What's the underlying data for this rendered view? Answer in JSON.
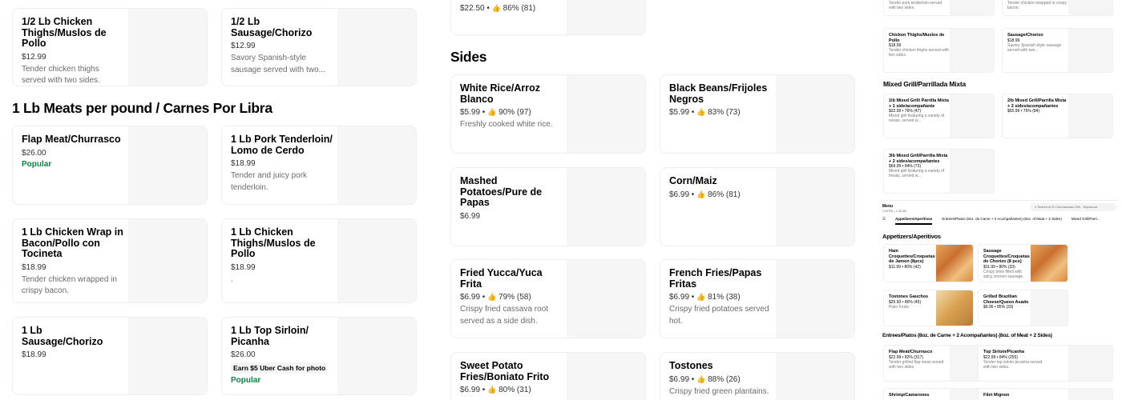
{
  "left": {
    "top_items": [
      {
        "name": "1/2 Lb Chicken Thighs/Muslos de Pollo",
        "price": "$12.99",
        "desc": "Tender chicken thighs served with two sides."
      },
      {
        "name": "1/2 Lb Sausage/Chorizo",
        "price": "$12.99",
        "desc": "Savory Spanish-style sausage served with two..."
      }
    ],
    "section_title": "1 Lb Meats per pound / Carnes Por Libra",
    "items": [
      {
        "name": "Flap Meat/Churrasco",
        "price": "$26.00",
        "popular": "Popular"
      },
      {
        "name": "1 Lb Pork Tenderloin/ Lomo de Cerdo",
        "price": "$18.99",
        "desc": "Tender and juicy pork tenderloin."
      },
      {
        "name": "1 Lb Chicken Wrap in Bacon/Pollo con Tocineta",
        "price": "$18.99",
        "desc": "Tender chicken wrapped in crispy bacon."
      },
      {
        "name": "1 Lb Chicken Thighs/Muslos de Pollo",
        "price": "$18.99",
        "desc": "."
      },
      {
        "name": "1 Lb Sausage/Chorizo",
        "price": "$18.99"
      },
      {
        "name": "1 Lb Top Sirloin/ Picanha",
        "price": "$26.00",
        "promo": "Earn $5 Uber Cash for photo",
        "popular": "Popular"
      }
    ]
  },
  "middle": {
    "top_item": {
      "price": "$22.50",
      "rating": "86% (81)"
    },
    "section_title": "Sides",
    "items": [
      {
        "name": "White Rice/Arroz Blanco",
        "price": "$5.99",
        "rating": "90% (97)",
        "desc": "Freshly cooked white rice."
      },
      {
        "name": "Black Beans/Frijoles Negros",
        "price": "$5.99",
        "rating": "83% (73)"
      },
      {
        "name": "Mashed Potatoes/Pure de Papas",
        "price": "$6.99"
      },
      {
        "name": "Corn/Maiz",
        "price": "$6.99",
        "rating": "86% (81)"
      },
      {
        "name": "Fried Yucca/Yuca Frita",
        "price": "$6.99",
        "rating": "79% (58)",
        "desc": "Crispy fried cassava root served as a side dish."
      },
      {
        "name": "French Fries/Papas Fritas",
        "price": "$6.99",
        "rating": "81% (38)",
        "desc": "Crispy fried potatoes served hot."
      },
      {
        "name": "Sweet Potato Fries/Boniato Frito",
        "price": "$6.99",
        "rating": "80% (31)"
      },
      {
        "name": "Tostones",
        "price": "$6.99",
        "rating": "88% (26)",
        "desc": "Crispy fried green plantains."
      }
    ]
  },
  "preview": {
    "top_row": [
      {
        "desc": "Tender pork tenderloin served with two sides."
      },
      {
        "desc": "Tender chicken wrapped in crispy bacon."
      }
    ],
    "row2": [
      {
        "name": "Chicken Thighs/Muslos de Pollo",
        "price": "$18.99",
        "desc": "Tender chicken thighs served with two sides."
      },
      {
        "name": "Sausage/Chorizo",
        "price": "$18.99",
        "desc": "Savory Spanish-style sausage served with two..."
      }
    ],
    "mixed_title": "Mixed Grill/Parrillada Mixta",
    "mixed": [
      {
        "name": "1lb Mixed Grill/ Parrilla Mixta + 1 side/acompañante",
        "price": "$32.99 • 76% (47)",
        "desc": "Mixed grill featuring a variety of meats, served w..."
      },
      {
        "name": "2lb Mixed Grill/Parrilla Mixta + 2 sides/acompañantes",
        "price": "$55.99 • 75% (84)"
      },
      {
        "name": "3lb Mixed Grill/Parrilla Mixta + 2 sides/acompañantes",
        "price": "$69.99 • 84% (73)",
        "desc": "Mixed grill featuring a variety of meats, served w..."
      }
    ],
    "menu_label": "Menu",
    "menu_hours": "1:00 PM – 1:30 AM",
    "search_placeholder": "Search in El Churrascaso Grill - Wynwood",
    "tabs": [
      "Appetizers/Aperitivos",
      "Entrees/Platos (8oz. de Carne + 2 Acompañantes) (8oz. of Meat + 2 Sides)",
      "Mixed Grill/Parri..."
    ],
    "appetizers_title": "Appetizers/Aperitivos",
    "appetizers": [
      {
        "name": "Ham Croquettes/Croquetas de Jamon (8pcs)",
        "price": "$11.99 • 80% (42)"
      },
      {
        "name": "Sausage Croquettes/Croquetas de Chorizo (8 pcs)",
        "price": "$11.99 • 80% (33)",
        "desc": "Crispy bites filled with spicy chorizo sausage."
      },
      {
        "name": "Tostones Gauchos",
        "price": "$20.50 • 86% (45)",
        "desc": "Plain Fruits"
      },
      {
        "name": "Grilled Brazilian Cheese/Queso Asado",
        "price": "$9.95 • 85% (33)"
      }
    ],
    "entrees_title": "Entrees/Platos (8oz. de Carne + 2 Acompañantes) (8oz. of Meat + 2 Sides)",
    "entrees": [
      {
        "name": "Flap Meat/Churrasco",
        "price": "$22.99 • 82% (317)",
        "desc": "Tender grilled flap meat served with two sides."
      },
      {
        "name": "Top Sirloin/Picanha",
        "price": "$22.99 • 84% (255)",
        "desc": "Tender top sirloin picanha served with two sides."
      },
      {
        "name": "Shrimp/Camarones",
        "price": ""
      },
      {
        "name": "Filet Mignon",
        "price": ""
      }
    ],
    "thumb_icon": "thumbs-up-icon"
  }
}
